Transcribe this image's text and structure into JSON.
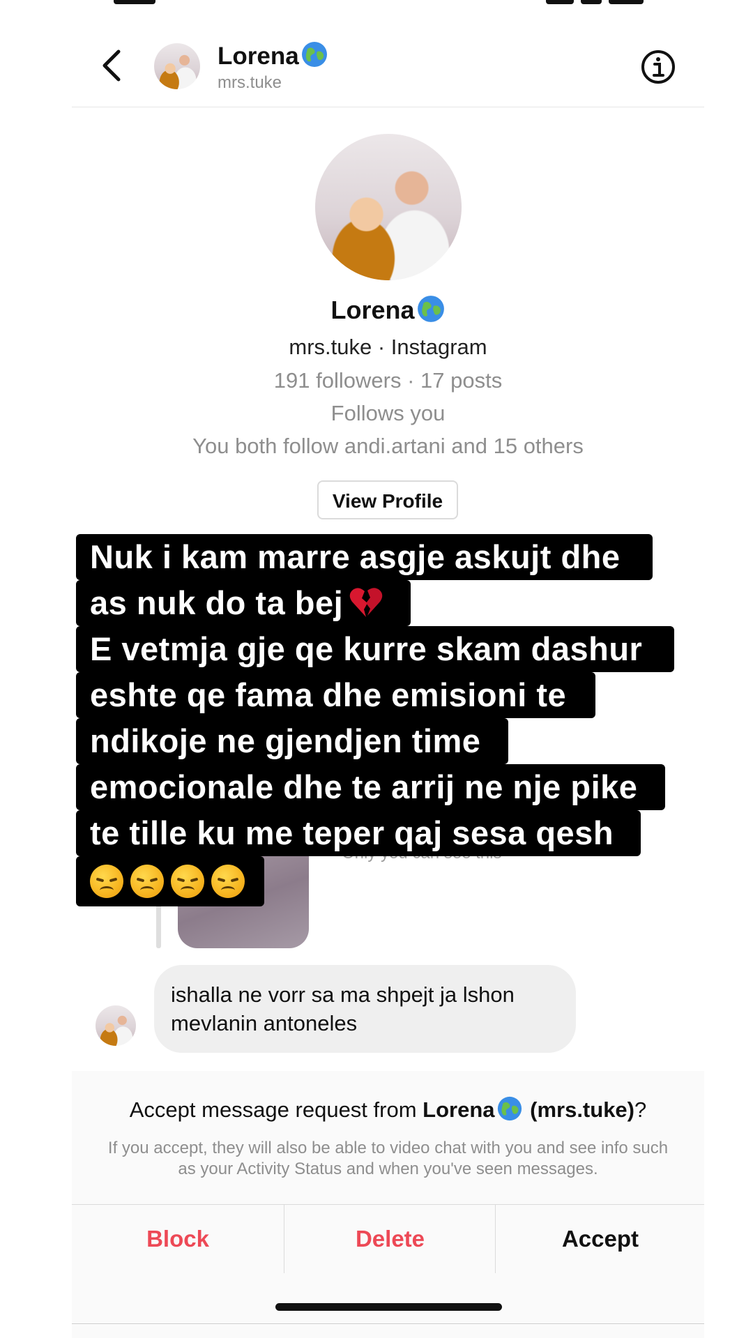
{
  "header": {
    "name": "Lorena",
    "username": "mrs.tuke"
  },
  "profile": {
    "name": "Lorena",
    "subtitle": "mrs.tuke · Instagram",
    "stats": "191 followers · 17 posts",
    "follows_you": "Follows you",
    "mutual": "You both follow andi.artani and 15 others",
    "view_profile_label": "View Profile"
  },
  "caption": {
    "lines": [
      "Nuk i kam marre asgje askujt dhe",
      "as nuk do ta bej",
      "E vetmja gje qe kurre skam dashur",
      "eshte qe fama dhe emisioni te",
      "ndikoje ne gjendjen time",
      "emocionale dhe te arrij ne nje pike",
      "te tille ku me teper qaj sesa qesh"
    ],
    "emoji_after_line_2": "broken-heart",
    "emoji_row": [
      "disappointed-face",
      "disappointed-face",
      "disappointed-face",
      "disappointed-face"
    ]
  },
  "hidden_message": {
    "note": "Only you can see this"
  },
  "message": {
    "text": "ishalla ne vorr sa ma shpejt ja lshon mevlanin antoneles"
  },
  "request": {
    "prefix": "Accept message request from ",
    "name": "Lorena",
    "username_part": " (mrs.tuke)",
    "suffix": "?",
    "note": "If you accept, they will also be able to video chat with you and see info such as your Activity Status and when you've seen messages."
  },
  "actions": {
    "block": "Block",
    "delete": "Delete",
    "accept": "Accept"
  },
  "colors": {
    "destructive": "#ed4956",
    "secondary_text": "#8e8e8e",
    "bubble": "#efefef",
    "caption_bg": "#000000"
  },
  "icons": [
    "chevron-left-icon",
    "info-icon",
    "globe-icon",
    "broken-heart-icon",
    "disappointed-face-icon"
  ]
}
